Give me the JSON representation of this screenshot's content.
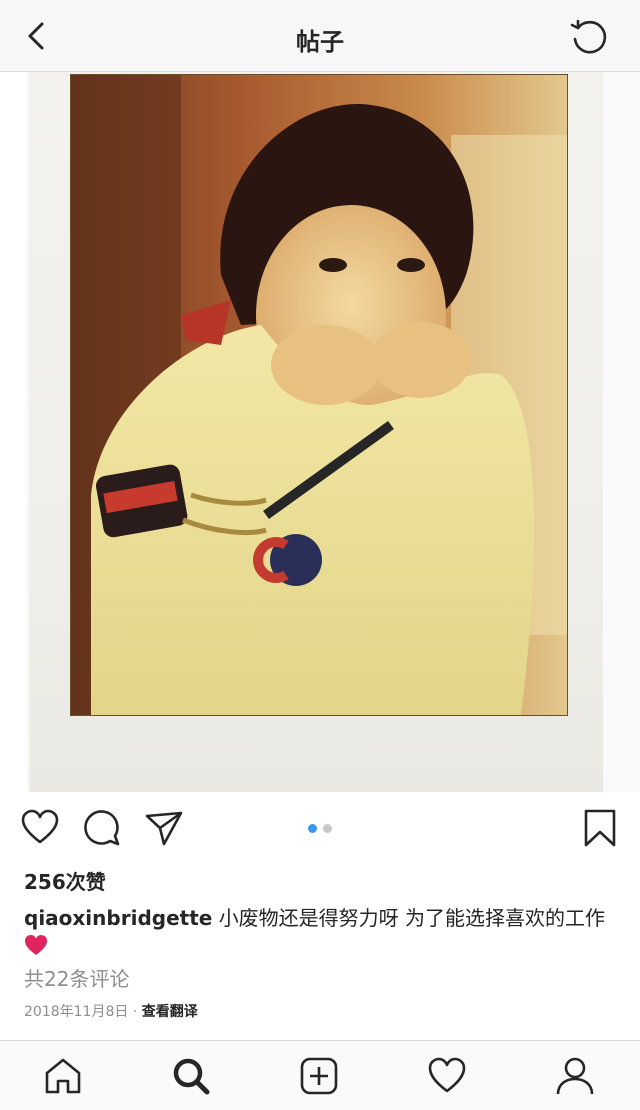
{
  "header": {
    "title": "帖子",
    "back_icon": "chevron-left-icon",
    "refresh_icon": "refresh-icon"
  },
  "post": {
    "carousel": {
      "total": 2,
      "active": 1,
      "active_color": "#3897f0",
      "inactive_color": "#c7c7c7"
    },
    "likes": "256次赞",
    "username": "qiaoxinbridgette",
    "caption_text": "小废物还是得努力呀 为了能选择喜欢的工作",
    "caption_emoji": "red-heart",
    "comments_link": "共22条评论",
    "date": "2018年11月8日",
    "separator": "·",
    "translate_link": "查看翻译"
  },
  "actions": {
    "like_icon": "heart-outline-icon",
    "comment_icon": "comment-bubble-icon",
    "share_icon": "send-icon",
    "save_icon": "bookmark-icon"
  },
  "tabbar": {
    "items": [
      "home-icon",
      "search-icon",
      "add-post-icon",
      "activity-heart-icon",
      "profile-icon"
    ],
    "active": "search-icon"
  },
  "colors": {
    "text": "#262626",
    "secondary_text": "#8e8e8e",
    "header_bg": "#f7f7f7",
    "divider": "#dbdbdb",
    "heart_red": "#e0245e"
  }
}
